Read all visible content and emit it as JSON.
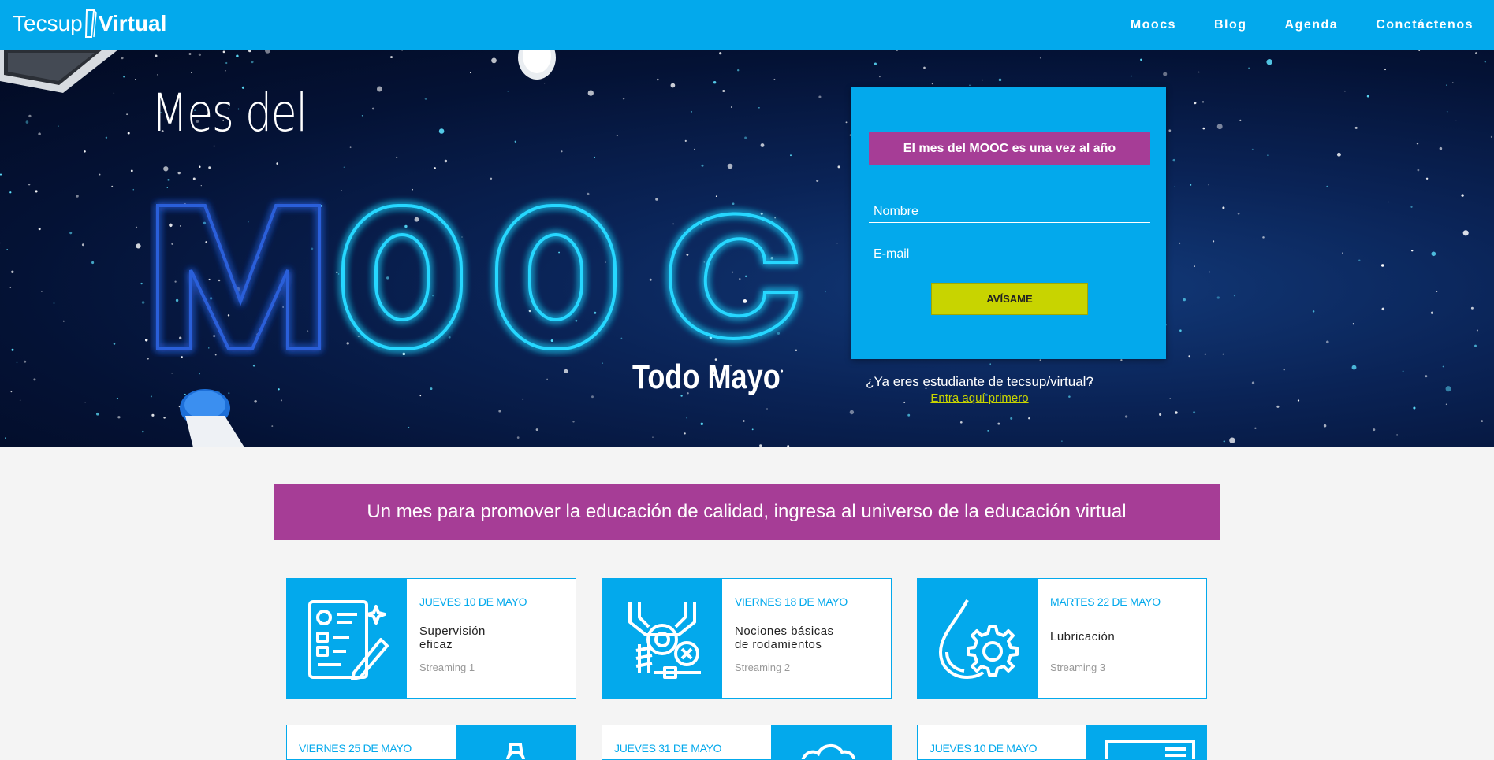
{
  "nav": {
    "logo_left": "Tecsup",
    "logo_right": "Virtual",
    "items": [
      {
        "label": "Moocs"
      },
      {
        "label": "Blog"
      },
      {
        "label": "Agenda"
      },
      {
        "label": "Conctáctenos"
      }
    ]
  },
  "hero": {
    "line1": "Mes del",
    "big_word": "MOOC",
    "subtitle": "Todo Mayo"
  },
  "form": {
    "banner": "El mes del MOOC es una vez al año",
    "name_placeholder": "Nombre",
    "email_placeholder": "E-mail",
    "submit_label": "AVÍSAME",
    "already_text": "¿Ya eres estudiante de tecsup/virtual?",
    "login_link": "Entra aquí primero"
  },
  "banner": {
    "text": "Un mes para promover la educación de calidad, ingresa al universo de la educación virtual"
  },
  "events": [
    {
      "date": "JUEVES 10 DE MAYO",
      "title": "Supervisión\neficaz",
      "stream": "Streaming 1",
      "icon": "checklist-icon"
    },
    {
      "date": "VIERNES 18 DE MAYO",
      "title": "Nociones básicas\nde rodamientos",
      "stream": "Streaming 2",
      "icon": "bearing-icon"
    },
    {
      "date": "MARTES 22 DE MAYO",
      "title": "Lubricación",
      "stream": "Streaming 3",
      "icon": "oil-drop-gear-icon"
    }
  ],
  "events_row2": [
    {
      "date": "VIERNES 25 DE MAYO",
      "icon": "gear-icon"
    },
    {
      "date": "JUEVES 31 DE MAYO",
      "icon": "cloud-icon"
    },
    {
      "date": "JUEVES 10 DE MAYO",
      "icon": "document-icon"
    }
  ],
  "colors": {
    "primary_blue": "#03a9ec",
    "purple": "#a63d96",
    "lime": "#c8d400"
  }
}
